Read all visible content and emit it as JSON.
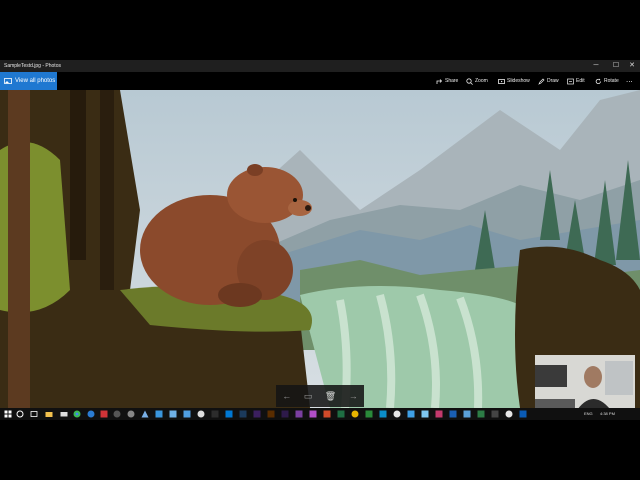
{
  "window": {
    "title": "SampleTestd.jpg - Photos",
    "controls": {
      "minimize": "─",
      "maximize": "☐",
      "close": "✕"
    }
  },
  "commandbar": {
    "view_all": "View all photos",
    "share": "Share",
    "zoom": "Zoom",
    "slideshow": "Slideshow",
    "draw": "Draw",
    "edit": "Edit",
    "rotate": "Rotate",
    "more": "..."
  },
  "filmstrip": {
    "prev": "←",
    "next": "→"
  },
  "taskbar": {
    "time": "4:38 PM",
    "language": "ENG",
    "apps": [
      "file-explorer",
      "chrome",
      "edge",
      "store",
      "mail",
      "media",
      "premiere",
      "after-effects",
      "photoshop",
      "illustrator",
      "onenote",
      "word",
      "excel",
      "outlook",
      "skype",
      "photos"
    ]
  },
  "colors": {
    "accent": "#1f78d1",
    "sky": "#c7d4dc",
    "bear": "#8b4a2c",
    "water": "#9ec9aa",
    "dark_foliage": "#2e2410"
  }
}
